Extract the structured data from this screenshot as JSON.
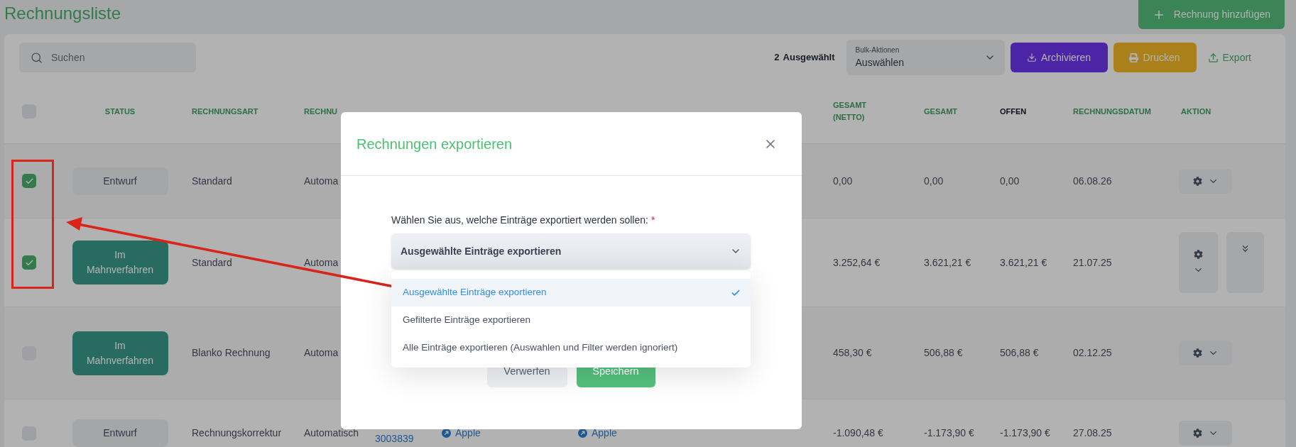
{
  "page": {
    "title": "Rechnungsliste",
    "add_button": "Rechnung hinzufügen"
  },
  "toolbar": {
    "search": {
      "placeholder": "Suchen"
    },
    "selected_count": "2",
    "selected_label": "Ausgewählt",
    "bulk": {
      "label": "Bulk-Aktionen",
      "value": "Auswählen"
    },
    "buttons": [
      {
        "kind": "archive",
        "label": "Archivieren"
      },
      {
        "kind": "print",
        "label": "Drucken"
      },
      {
        "kind": "export",
        "label": "Export"
      }
    ]
  },
  "table": {
    "select_all": {
      "checked": false
    },
    "columns": [
      {
        "label": "STATUS",
        "active": false
      },
      {
        "label": "RECHNUNGSART",
        "active": false
      },
      {
        "label": "RECHNU",
        "active": false
      },
      {
        "label": "GESAMT (NETTO)",
        "active": false
      },
      {
        "label": "GESAMT",
        "active": false
      },
      {
        "label": "OFFEN",
        "active": true
      },
      {
        "label": "RECHNUNGSDATUM",
        "active": false
      },
      {
        "label": "AKTION",
        "active": false
      }
    ],
    "rows": [
      {
        "checked": true,
        "status": {
          "label": "Entwurf",
          "kind": "draft"
        },
        "type": "Standard",
        "mode": "Automa",
        "net": "0,00",
        "total": "0,00",
        "open": "0,00",
        "date": "06.08.26",
        "actions": {
          "kind": "compact"
        }
      },
      {
        "checked": true,
        "status": {
          "label": "Im Mahnverfahren",
          "kind": "dunning"
        },
        "type": "Standard",
        "mode": "Automa",
        "net": "3.252,64 €",
        "total": "3.621,21 €",
        "open": "3.621,21 €",
        "date": "21.07.25",
        "actions": {
          "kind": "stacked"
        }
      },
      {
        "checked": false,
        "status": {
          "label": "Im Mahnverfahren",
          "kind": "dunning"
        },
        "type": "Blanko Rechnung",
        "mode": "Automa",
        "net": "458,30 €",
        "total": "506,88 €",
        "open": "506,88 €",
        "date": "02.12.25",
        "actions": {
          "kind": "compact"
        }
      },
      {
        "checked": false,
        "status": {
          "label": "Entwurf",
          "kind": "draft"
        },
        "type": "Rechnungskorrektur",
        "mode": "Automatisch",
        "number": "3003839",
        "customer": "Apple",
        "recipient": "Apple",
        "net": "-1.090,48 €",
        "total": "-1.173,90 €",
        "open": "-1.173,90 €",
        "date": "27.08.25",
        "actions": {
          "kind": "compact"
        }
      }
    ]
  },
  "modal": {
    "title": "Rechnungen exportieren",
    "field_label": "Wählen Sie aus, welche Einträge exportiert werden sollen:",
    "required_mark": "*",
    "value": "Ausgewählte Einträge exportieren",
    "options": [
      {
        "label": "Ausgewählte Einträge exportieren",
        "selected": true
      },
      {
        "label": "Gefilterte Einträge exportieren",
        "selected": false
      },
      {
        "label": "Alle Einträge exportieren (Auswahlen und Filter werden ignoriert)",
        "selected": false
      }
    ],
    "buttons": [
      {
        "kind": "secondary",
        "label": "Verwerfen"
      },
      {
        "kind": "primary",
        "label": "Speichern"
      }
    ]
  }
}
